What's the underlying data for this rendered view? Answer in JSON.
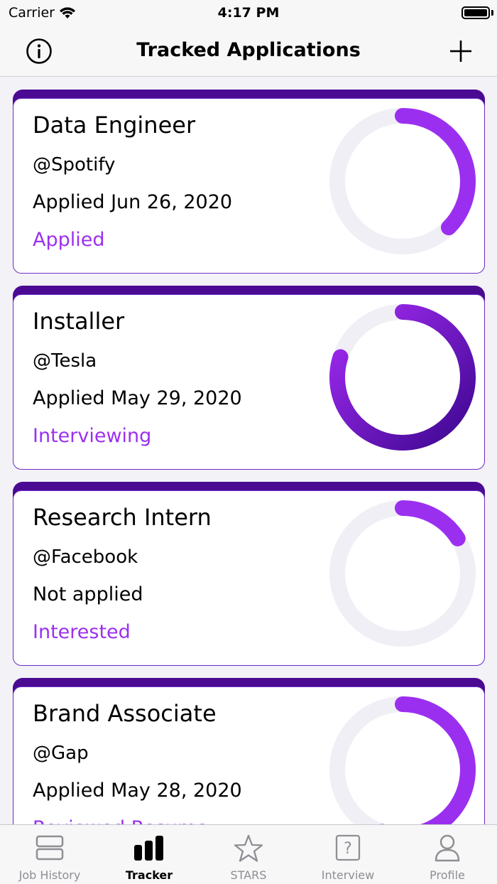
{
  "status_bar": {
    "carrier": "Carrier",
    "time": "4:17 PM"
  },
  "nav": {
    "title": "Tracked Applications",
    "info_icon": "info-icon",
    "add_icon": "plus-icon"
  },
  "colors": {
    "accent": "#9b30f0",
    "card_header": "#4a0a92",
    "ring_track": "#f0eff5"
  },
  "applications": [
    {
      "title": "Data Engineer",
      "company": "@Spotify",
      "applied": "Applied Jun 26, 2020",
      "status": "Applied",
      "progress": 0.375
    },
    {
      "title": "Installer",
      "company": "@Tesla",
      "applied": "Applied May 29, 2020",
      "status": "Interviewing",
      "progress": 0.8
    },
    {
      "title": "Research Intern",
      "company": "@Facebook",
      "applied": "Not applied",
      "status": "Interested",
      "progress": 0.16
    },
    {
      "title": "Brand Associate",
      "company": "@Gap",
      "applied": "Applied May 28, 2020",
      "status": "Reviewed Resume",
      "progress": 0.55
    }
  ],
  "tabs": [
    {
      "label": "Job History",
      "icon": "job-history-icon",
      "active": false
    },
    {
      "label": "Tracker",
      "icon": "bar-chart-icon",
      "active": true
    },
    {
      "label": "STARS",
      "icon": "star-icon",
      "active": false
    },
    {
      "label": "Interview",
      "icon": "question-icon",
      "active": false
    },
    {
      "label": "Profile",
      "icon": "person-icon",
      "active": false
    }
  ]
}
